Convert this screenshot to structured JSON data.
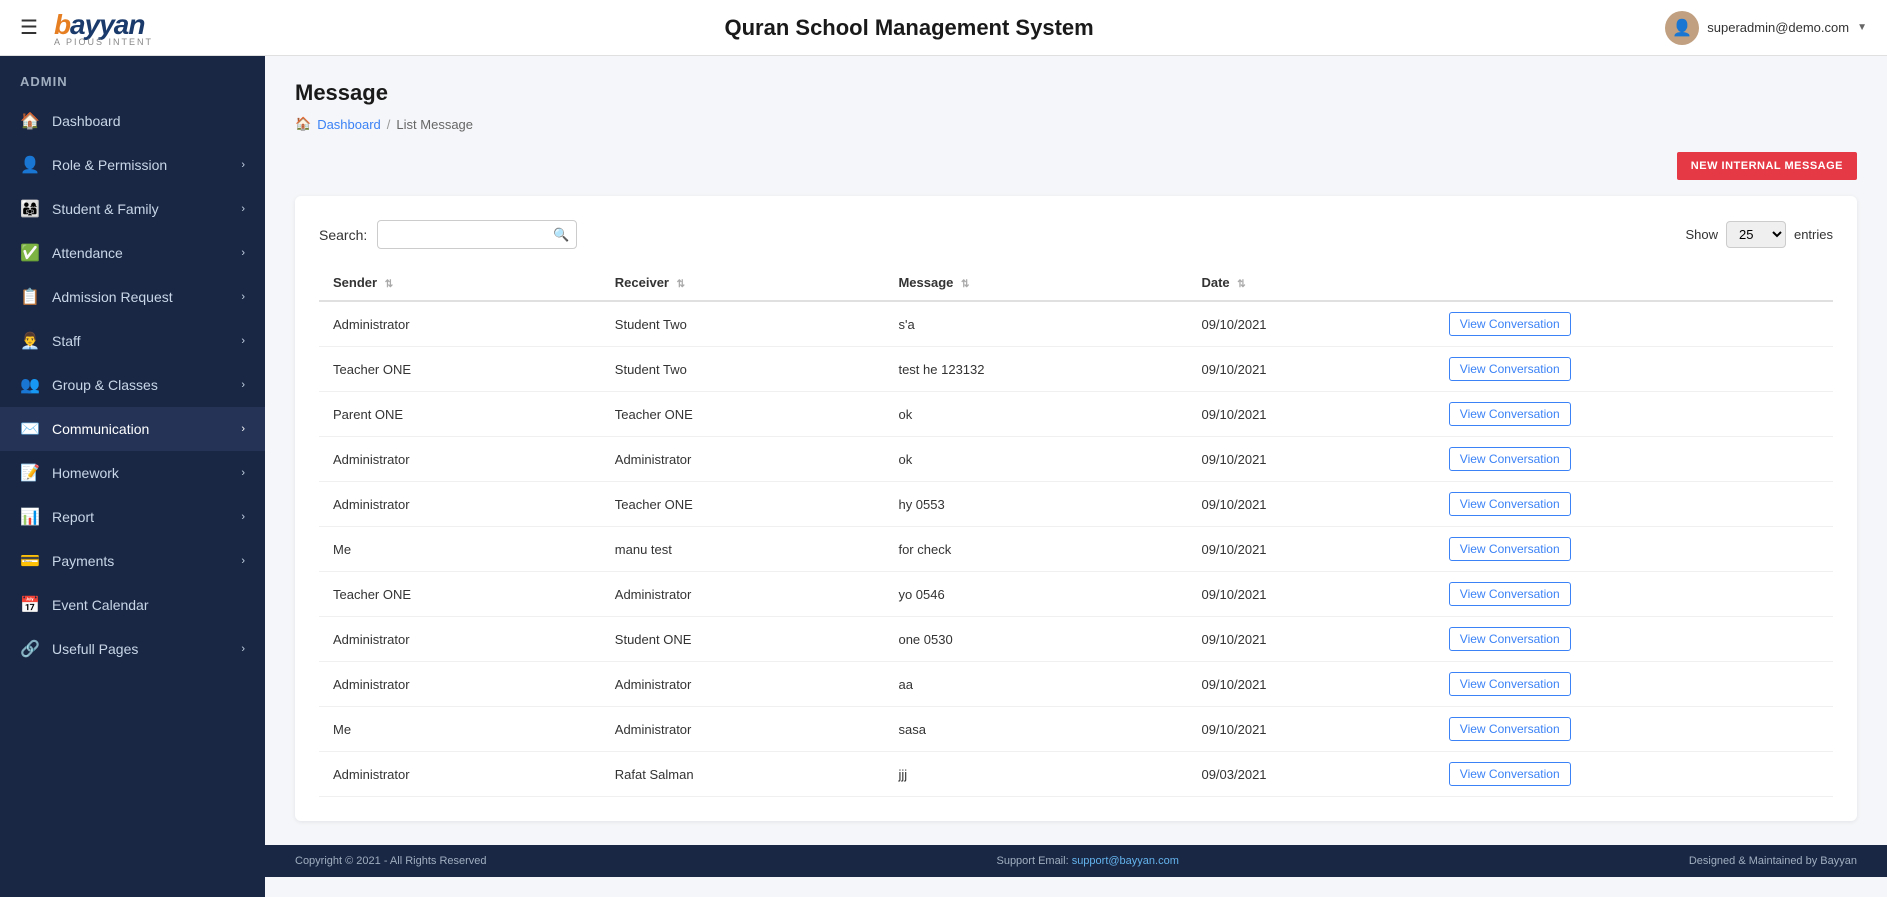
{
  "header": {
    "hamburger": "☰",
    "logo_main": "bayyan",
    "logo_highlight": "b",
    "logo_sub": "A PIOUS INTENT",
    "page_title": "Quran School Management System",
    "user_email": "superadmin@demo.com",
    "dropdown_arrow": "▼"
  },
  "sidebar": {
    "admin_label": "ADMIN",
    "items": [
      {
        "id": "dashboard",
        "icon": "🏠",
        "label": "Dashboard",
        "has_chevron": false
      },
      {
        "id": "role-permission",
        "icon": "👤",
        "label": "Role & Permission",
        "has_chevron": true
      },
      {
        "id": "student-family",
        "icon": "👨‍👩‍👧",
        "label": "Student & Family",
        "has_chevron": true
      },
      {
        "id": "attendance",
        "icon": "✅",
        "label": "Attendance",
        "has_chevron": true
      },
      {
        "id": "admission-request",
        "icon": "📋",
        "label": "Admission Request",
        "has_chevron": true
      },
      {
        "id": "staff",
        "icon": "👨‍💼",
        "label": "Staff",
        "has_chevron": true
      },
      {
        "id": "group-classes",
        "icon": "👥",
        "label": "Group & Classes",
        "has_chevron": true
      },
      {
        "id": "communication",
        "icon": "✉️",
        "label": "Communication",
        "has_chevron": true
      },
      {
        "id": "homework",
        "icon": "📝",
        "label": "Homework",
        "has_chevron": true
      },
      {
        "id": "report",
        "icon": "📊",
        "label": "Report",
        "has_chevron": true
      },
      {
        "id": "payments",
        "icon": "💳",
        "label": "Payments",
        "has_chevron": true
      },
      {
        "id": "event-calendar",
        "icon": "📅",
        "label": "Event Calendar",
        "has_chevron": false
      },
      {
        "id": "usefull-pages",
        "icon": "🔗",
        "label": "Usefull Pages",
        "has_chevron": true
      }
    ],
    "footer": "Copyright © 2021 - All Rights Reserved"
  },
  "content": {
    "page_title": "Message",
    "breadcrumb": {
      "home_icon": "🏠",
      "home_label": "Dashboard",
      "separator": "/",
      "current": "List Message"
    },
    "new_message_button": "NEW INTERNAL MESSAGE",
    "search_label": "Search:",
    "search_placeholder": "",
    "show_label": "Show",
    "show_value": "25",
    "entries_label": "entries",
    "table": {
      "columns": [
        {
          "id": "sender",
          "label": "Sender"
        },
        {
          "id": "receiver",
          "label": "Receiver"
        },
        {
          "id": "message",
          "label": "Message"
        },
        {
          "id": "date",
          "label": "Date"
        },
        {
          "id": "action",
          "label": ""
        }
      ],
      "rows": [
        {
          "sender": "Administrator",
          "receiver": "Student Two",
          "message": "s'a",
          "date": "09/10/2021",
          "action": "View Conversation"
        },
        {
          "sender": "Teacher ONE",
          "receiver": "Student Two",
          "message": "test he 123132",
          "date": "09/10/2021",
          "action": "View Conversation"
        },
        {
          "sender": "Parent ONE",
          "receiver": "Teacher ONE",
          "message": "ok",
          "date": "09/10/2021",
          "action": "View Conversation"
        },
        {
          "sender": "Administrator",
          "receiver": "Administrator",
          "message": "ok",
          "date": "09/10/2021",
          "action": "View Conversation"
        },
        {
          "sender": "Administrator",
          "receiver": "Teacher ONE",
          "message": "hy 0553",
          "date": "09/10/2021",
          "action": "View Conversation"
        },
        {
          "sender": "Me",
          "receiver": "manu test",
          "message": "for check",
          "date": "09/10/2021",
          "action": "View Conversation"
        },
        {
          "sender": "Teacher ONE",
          "receiver": "Administrator",
          "message": "yo 0546",
          "date": "09/10/2021",
          "action": "View Conversation"
        },
        {
          "sender": "Administrator",
          "receiver": "Student ONE",
          "message": "one 0530",
          "date": "09/10/2021",
          "action": "View Conversation"
        },
        {
          "sender": "Administrator",
          "receiver": "Administrator",
          "message": "aa",
          "date": "09/10/2021",
          "action": "View Conversation"
        },
        {
          "sender": "Me",
          "receiver": "Administrator",
          "message": "sasa",
          "date": "09/10/2021",
          "action": "View Conversation"
        },
        {
          "sender": "Administrator",
          "receiver": "Rafat Salman",
          "message": "jjj",
          "date": "09/03/2021",
          "action": "View Conversation"
        }
      ]
    }
  },
  "footer": {
    "copyright": "Copyright © 2021 - All Rights Reserved",
    "support_label": "Support Email:",
    "support_email": "support@bayyan.com",
    "designed_by": "Designed & Maintained by Bayyan"
  },
  "colors": {
    "sidebar_bg": "#1a2744",
    "accent_blue": "#3b82f6",
    "accent_red": "#e63946",
    "header_bg": "#ffffff"
  }
}
